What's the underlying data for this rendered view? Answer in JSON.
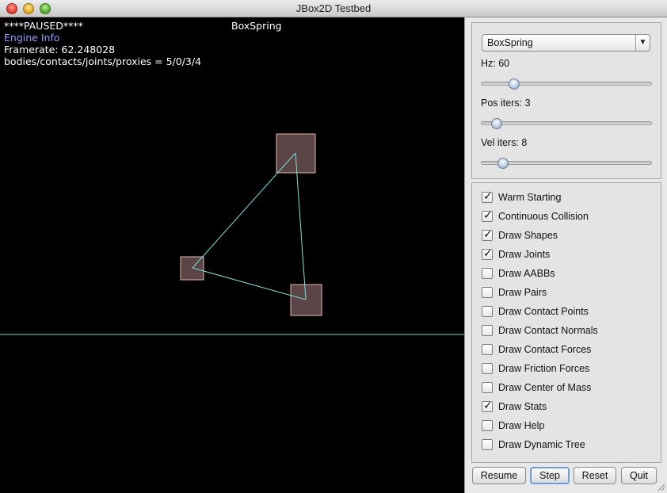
{
  "window": {
    "title": "JBox2D Testbed"
  },
  "canvas": {
    "status": "****PAUSED****",
    "test_name": "BoxSpring",
    "engine_info": "Engine Info",
    "framerate": "Framerate: 62.248028",
    "counts": "bodies/contacts/joints/proxies = 5/0/3/4",
    "colors": {
      "background": "#000000",
      "body_fill": "#5a4446",
      "body_stroke": "#e6b8b0",
      "joint": "#7fe0e0",
      "ground": "#7fe0b8",
      "info_text": "#9b9bff"
    }
  },
  "controls": {
    "test_select": {
      "value": "BoxSpring"
    },
    "sliders": [
      {
        "label": "Hz: 60",
        "level": 0.17
      },
      {
        "label": "Pos iters: 3",
        "level": 0.06
      },
      {
        "label": "Vel iters: 8",
        "level": 0.1
      }
    ],
    "checkboxes": [
      {
        "label": "Warm Starting",
        "checked": true
      },
      {
        "label": "Continuous Collision",
        "checked": true
      },
      {
        "label": "Draw Shapes",
        "checked": true
      },
      {
        "label": "Draw Joints",
        "checked": true
      },
      {
        "label": "Draw AABBs",
        "checked": false
      },
      {
        "label": "Draw Pairs",
        "checked": false
      },
      {
        "label": "Draw Contact Points",
        "checked": false
      },
      {
        "label": "Draw Contact Normals",
        "checked": false
      },
      {
        "label": "Draw Contact Forces",
        "checked": false
      },
      {
        "label": "Draw Friction Forces",
        "checked": false
      },
      {
        "label": "Draw Center of Mass",
        "checked": false
      },
      {
        "label": "Draw Stats",
        "checked": true
      },
      {
        "label": "Draw Help",
        "checked": false
      },
      {
        "label": "Draw Dynamic Tree",
        "checked": false
      }
    ],
    "buttons": {
      "resume": "Resume",
      "step": "Step",
      "reset": "Reset",
      "quit": "Quit"
    }
  }
}
